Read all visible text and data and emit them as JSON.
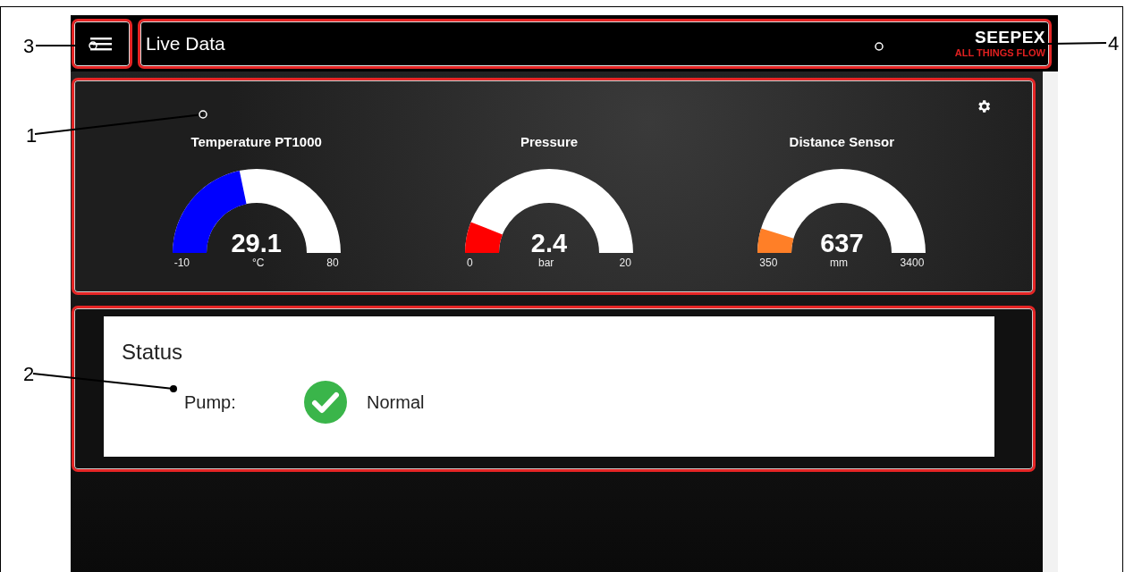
{
  "header": {
    "title": "Live Data",
    "logo": {
      "name": "SEEPEX",
      "tagline": "ALL THINGS FLOW"
    }
  },
  "gauges": [
    {
      "title": "Temperature PT1000",
      "value": "29.1",
      "unit": "°C",
      "min": "-10",
      "max": "80",
      "color": "#0000ff"
    },
    {
      "title": "Pressure",
      "value": "2.4",
      "unit": "bar",
      "min": "0",
      "max": "20",
      "color": "#ff0000"
    },
    {
      "title": "Distance Sensor",
      "value": "637",
      "unit": "mm",
      "min": "350",
      "max": "3400",
      "color": "#ff7f27"
    }
  ],
  "status": {
    "title": "Status",
    "items": [
      {
        "label": "Pump:",
        "kind": "ok",
        "value": "Normal"
      }
    ]
  },
  "callouts": [
    {
      "number": "3"
    },
    {
      "number": "4"
    },
    {
      "number": "1"
    },
    {
      "number": "2"
    }
  ]
}
